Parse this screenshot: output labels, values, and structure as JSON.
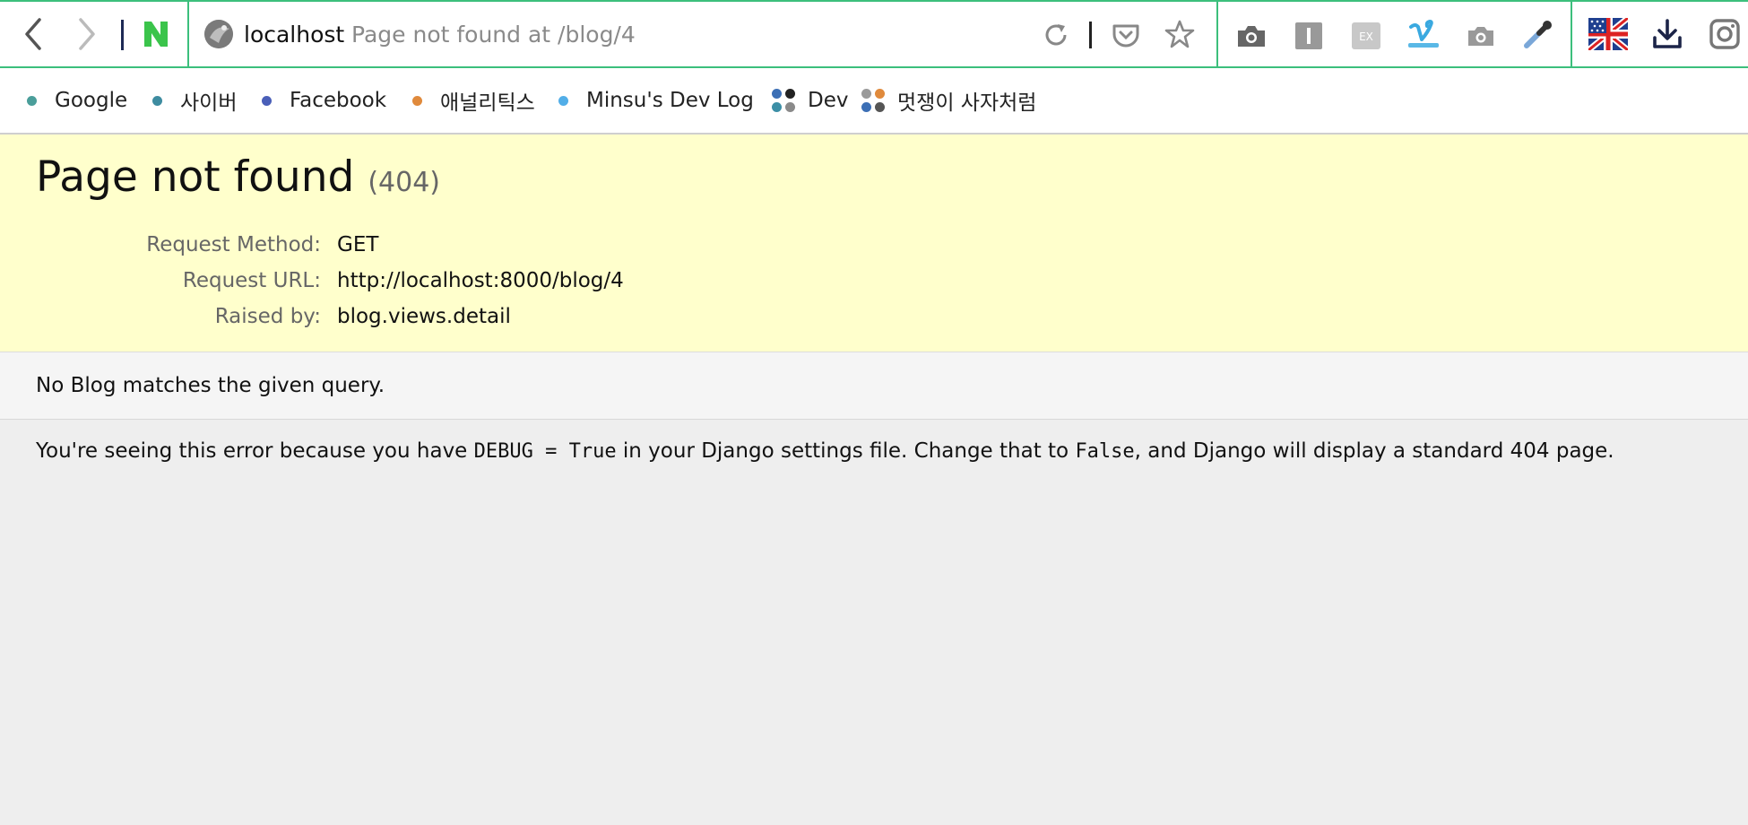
{
  "toolbar": {
    "back_icon": "back-arrow-icon",
    "forward_icon": "forward-arrow-icon",
    "home_icon": "naver-n-logo",
    "address": {
      "host": "localhost",
      "page_title": "Page not found at /blog/4"
    },
    "right_icons": [
      "reload-icon",
      "pocket-icon",
      "star-icon",
      "camera-icon",
      "reader-icon",
      "ex-icon",
      "vimeo-icon",
      "screenshot-icon",
      "eyedropper-icon",
      "flag-uk-us-icon",
      "download-icon",
      "instagram-icon"
    ]
  },
  "bookmarks": [
    {
      "label": "Google",
      "dot_color": "#4a9e9a"
    },
    {
      "label": "사이버",
      "dot_color": "#3e8ca0"
    },
    {
      "label": "Facebook",
      "dot_color": "#4a5fb8"
    },
    {
      "label": "애널리틱스",
      "dot_color": "#e08a3c"
    },
    {
      "label": "Minsu's Dev Log",
      "dot_color": "#52aee8"
    },
    {
      "label": "Dev",
      "folder_colors": [
        "#3c6fb5",
        "#222222",
        "#3c8fa6",
        "#8a8a8a"
      ]
    },
    {
      "label": "멋쟁이 사자처럼",
      "folder_colors": [
        "#9a9a9a",
        "#e08a3c",
        "#3c6fb5",
        "#555555"
      ]
    }
  ],
  "error": {
    "title": "Page not found",
    "code": "(404)",
    "meta": [
      {
        "key": "Request Method:",
        "value": "GET"
      },
      {
        "key": "Request URL:",
        "value": "http://localhost:8000/blog/4"
      },
      {
        "key": "Raised by:",
        "value": "blog.views.detail"
      }
    ],
    "message": "No Blog matches the given query.",
    "explanation": {
      "part1": "You're seeing this error because you have ",
      "code1": "DEBUG = True",
      "part2": " in your Django settings file. Change that to ",
      "code2": "False",
      "part3": ", and Django will display a standard 404 page."
    }
  }
}
